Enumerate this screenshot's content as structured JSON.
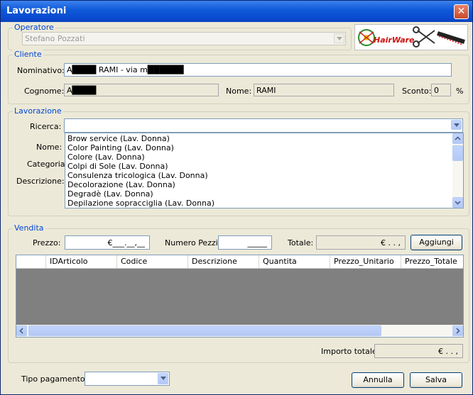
{
  "window": {
    "title": "Lavorazioni"
  },
  "operatore": {
    "legend": "Operatore",
    "value": "Stefano Pozzati"
  },
  "logo": {
    "text": "HairWare"
  },
  "cliente": {
    "legend": "Cliente",
    "nominativo_label": "Nominativo:",
    "nominativo_value": "A████ RAMI - via m██████",
    "cognome_label": "Cognome:",
    "cognome_value": "A████",
    "nome_label": "Nome:",
    "nome_value": "RAMI",
    "sconto_label": "Sconto:",
    "sconto_value": "0",
    "percent": "%"
  },
  "lavorazione": {
    "legend": "Lavorazione",
    "ricerca_label": "Ricerca:",
    "ricerca_value": "",
    "nome_label": "Nome:",
    "categoria_label": "Categoria:",
    "descrizione_label": "Descrizione:",
    "items": [
      "Brow service (Lav. Donna)",
      "Color Painting (Lav. Donna)",
      "Colore (Lav. Donna)",
      "Colpi di Sole (Lav. Donna)",
      "Consulenza tricologica (Lav. Donna)",
      "Decolorazione (Lav. Donna)",
      "Degradè (Lav. Donna)",
      "Depilazione sopracciglia (Lav. Donna)"
    ]
  },
  "vendita": {
    "legend": "Vendita",
    "prezzo_label": "Prezzo:",
    "prezzo_value": "€___.__,__",
    "pezzi_label": "Numero Pezzi:",
    "pezzi_value": "_____",
    "totale_label": "Totale:",
    "totale_value": "€ .  .  ,",
    "aggiungi": "Aggiungi",
    "columns": [
      "IDArticolo",
      "Codice",
      "Descrizione",
      "Quantita",
      "Prezzo_Unitario",
      "Prezzo_Totale"
    ],
    "importo_label": "Importo totale:",
    "importo_value": "€ .  .  ,"
  },
  "footer": {
    "tipo_pagamento_label": "Tipo pagamento:",
    "tipo_pagamento_value": "",
    "annulla": "Annulla",
    "salva": "Salva"
  }
}
